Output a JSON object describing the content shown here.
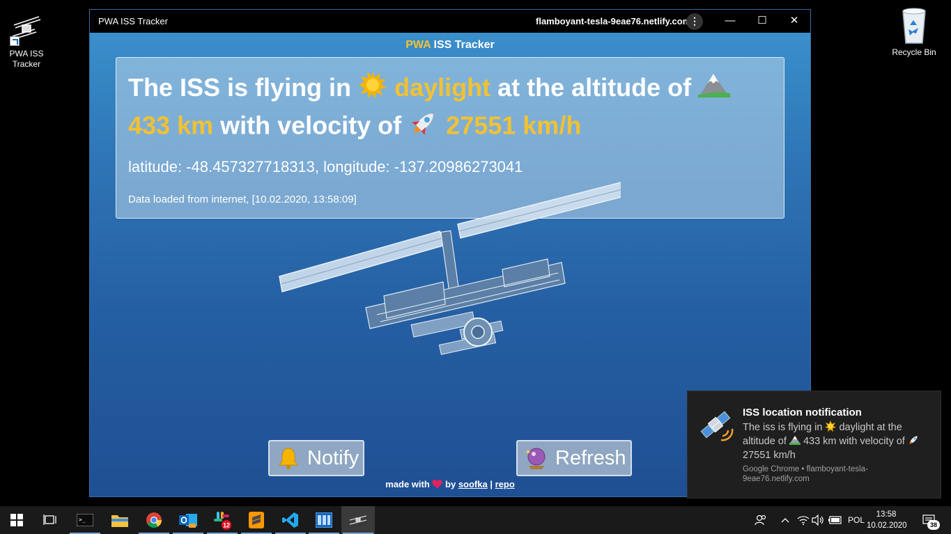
{
  "desktop": {
    "icons": [
      {
        "label": "PWA ISS\nTracker",
        "line1": "PWA ISS",
        "line2": "Tracker"
      },
      {
        "label": "Recycle Bin"
      }
    ]
  },
  "window": {
    "title": "PWA ISS Tracker",
    "url": "flamboyant-tesla-9eae76.netlify.com",
    "menu_glyph": "⋮",
    "min_glyph": "—",
    "max_glyph": "☐",
    "close_glyph": "✕"
  },
  "app": {
    "header_accent": "PWA",
    "header_rest": " ISS Tracker",
    "headline": {
      "p1": "The ISS is flying in ",
      "visibility": "daylight",
      "p2": " at the altitude of ",
      "altitude": "433 km",
      "p3": " with velocity of ",
      "velocity": "27551 km/h"
    },
    "coords": "latitude: -48.457327718313, longitude: -137.20986273041",
    "loaded": "Data loaded from internet, [10.02.2020, 13:58:09]",
    "notify_label": "Notify",
    "refresh_label": "Refresh",
    "footer": {
      "made_with": "made with ",
      "by": " by ",
      "author": "soofka",
      "sep": " | ",
      "repo": "repo"
    }
  },
  "toast": {
    "title": "ISS location notification",
    "b1": "The iss is flying in ",
    "b2": " daylight at the altitude of ",
    "b3": " 433 km with velocity of ",
    "b4": " 27551 km/h",
    "source": "Google Chrome • flamboyant-tesla-9eae76.netlify.com"
  },
  "taskbar": {
    "lang": "POL",
    "time": "13:58",
    "date": "10.02.2020",
    "notifications": "38",
    "slack_badge": "12"
  },
  "colors": {
    "accent": "#f2c233",
    "bg_top": "#3a8fcb",
    "bg_bottom": "#1f4f93"
  }
}
